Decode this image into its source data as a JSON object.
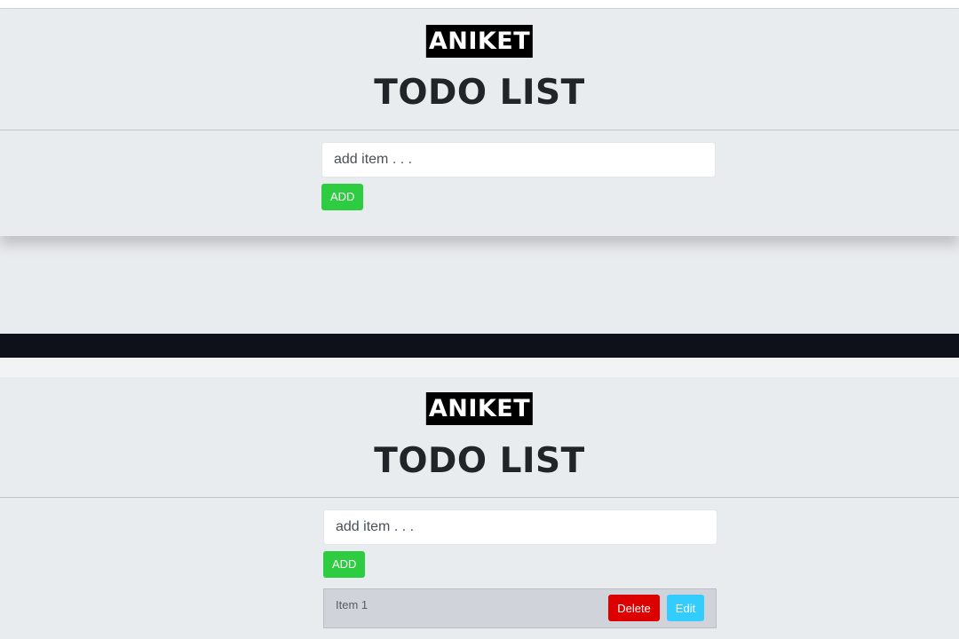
{
  "screens": [
    {
      "brand": "ANIKET",
      "title": "TODO LIST",
      "input_placeholder": "add item . . .",
      "add_label": "ADD",
      "items": []
    },
    {
      "brand": "ANIKET",
      "title": "TODO LIST",
      "input_placeholder": "add item . . .",
      "add_label": "ADD",
      "items": [
        {
          "text": "Item 1",
          "delete_label": "Delete",
          "edit_label": "Edit"
        }
      ]
    }
  ],
  "colors": {
    "background": "#e9ecef",
    "brand_bg": "#000000",
    "add_button": "#2ecc40",
    "delete_button": "#dd0000",
    "edit_button": "#33ccff",
    "divider_bar": "#0e111a"
  }
}
